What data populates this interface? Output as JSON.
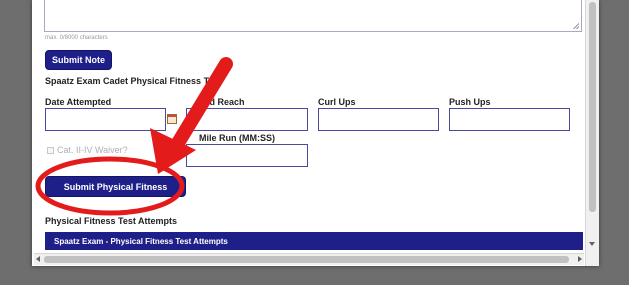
{
  "note": {
    "max_chars_text": "max. 0/8000 characters",
    "submit_label": "Submit Note"
  },
  "pft": {
    "section_title": "Spaatz Exam Cadet Physical Fitness Test",
    "fields": {
      "date_attempted": {
        "label": "Date Attempted",
        "value": ""
      },
      "sit_and_reach": {
        "label": "and Reach",
        "value": ""
      },
      "curl_ups": {
        "label": "Curl Ups",
        "value": ""
      },
      "push_ups": {
        "label": "Push Ups",
        "value": ""
      },
      "mile_run": {
        "label": "Mile Run (MM:SS)",
        "value": ""
      }
    },
    "waiver_label": "Cat. II-IV Waiver?",
    "waiver_checked": false,
    "submit_label": "Submit Physical Fitness"
  },
  "attempts": {
    "heading": "Physical Fitness Test Attempts",
    "table_header": "Spaatz Exam - Physical Fitness Test Attempts"
  },
  "colors": {
    "accent": "#1f1f8a",
    "annotation": "#e41b1b",
    "backdrop": "#6e6e6e"
  }
}
